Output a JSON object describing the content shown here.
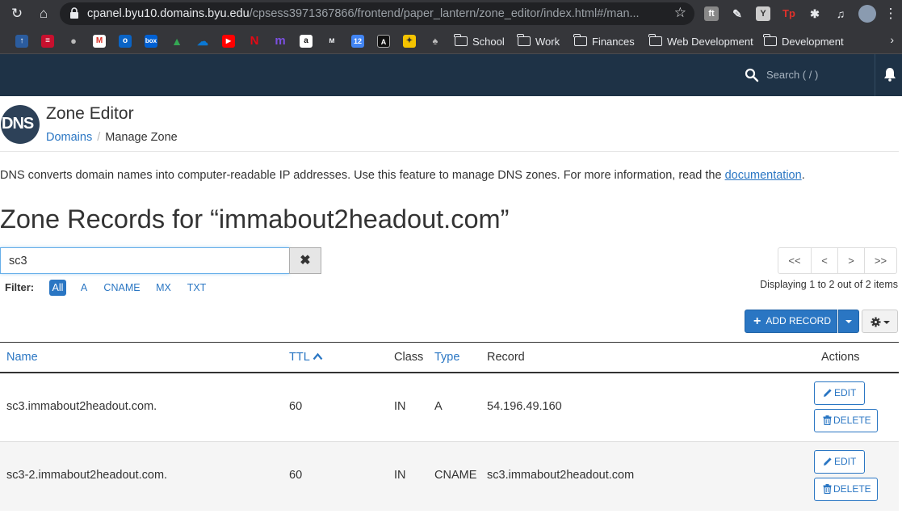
{
  "browser": {
    "url_host": "cpanel.byu10.domains.byu.edu",
    "url_path": "/cpsess3971367866/frontend/paper_lantern/zone_editor/index.html#/man...",
    "bookmark_folders": [
      "School",
      "Work",
      "Finances",
      "Web Development",
      "Development"
    ]
  },
  "topbar": {
    "search_placeholder": "Search ( / )"
  },
  "header": {
    "logo_text": "DNS",
    "title": "Zone Editor",
    "breadcrumb_link": "Domains",
    "breadcrumb_separator": "/",
    "breadcrumb_current": "Manage Zone"
  },
  "description": {
    "text": "DNS converts domain names into computer-readable IP addresses. Use this feature to manage DNS zones. For more information, read the ",
    "link": "documentation",
    "trailing": "."
  },
  "zone_heading": "Zone Records for “immabout2headout.com”",
  "search": {
    "value": "sc3",
    "clear_symbol": "✖"
  },
  "filter": {
    "label": "Filter:",
    "options": [
      "All",
      "A",
      "CNAME",
      "MX",
      "TXT"
    ],
    "active": "All"
  },
  "pagination": {
    "first": "<<",
    "prev": "<",
    "next": ">",
    "last": ">>",
    "status": "Displaying 1 to 2 out of 2 items"
  },
  "actions": {
    "add_record": "ADD RECORD"
  },
  "table": {
    "headers": {
      "name": "Name",
      "ttl": "TTL",
      "class": "Class",
      "type": "Type",
      "record": "Record",
      "actions": "Actions"
    },
    "rows": [
      {
        "name": "sc3.immabout2headout.com.",
        "ttl": "60",
        "class": "IN",
        "type": "A",
        "record": "54.196.49.160",
        "edit": "EDIT",
        "delete": "DELETE"
      },
      {
        "name": "sc3-2.immabout2headout.com.",
        "ttl": "60",
        "class": "IN",
        "type": "CNAME",
        "record": "sc3.immabout2headout.com",
        "edit": "EDIT",
        "delete": "DELETE"
      }
    ]
  },
  "colors": {
    "accent": "#2a76c3",
    "topbar": "#1e3246",
    "chrome": "#35363a"
  }
}
